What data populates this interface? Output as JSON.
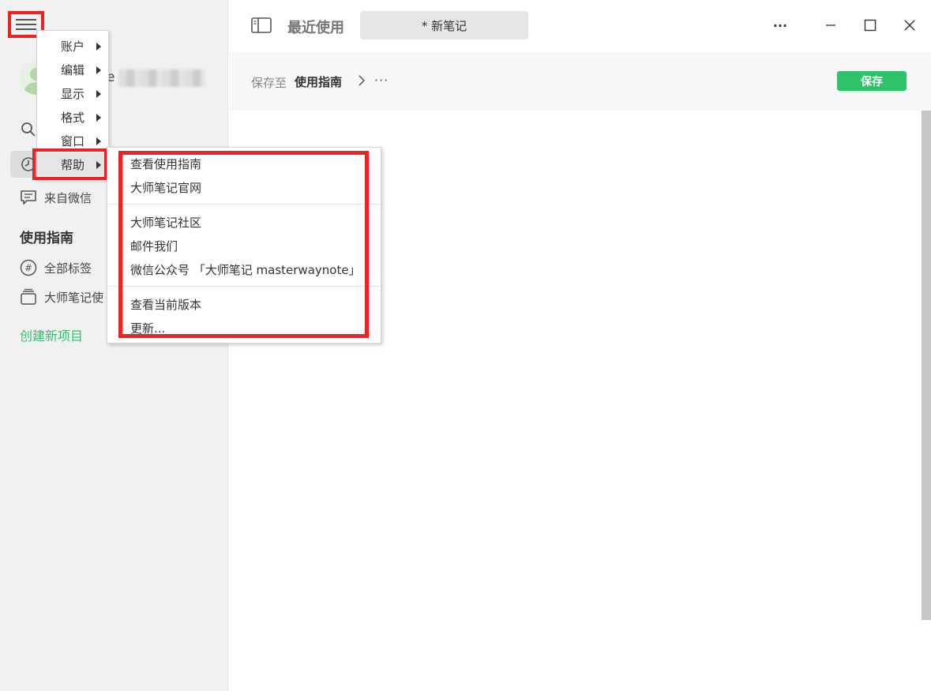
{
  "sidebar": {
    "username_visible": "e",
    "items": [
      {
        "label": "",
        "icon": "search-icon"
      },
      {
        "label": "",
        "icon": "clock-icon"
      },
      {
        "label": "来自微信",
        "icon": "chat-icon"
      }
    ],
    "section_title": "使用指南",
    "section_items": [
      {
        "label": "全部标签",
        "icon": "hash-icon"
      },
      {
        "label": "大师笔记使",
        "icon": "stack-icon"
      }
    ],
    "create_label": "创建新项目"
  },
  "topbar": {
    "recent_label": "最近使用",
    "tab_label": "* 新笔记",
    "more_label": "···"
  },
  "subbar": {
    "saveto_prefix": "保存至",
    "saveto_target": "使用指南",
    "more_label": "···",
    "save_label": "保存"
  },
  "menu": {
    "items": [
      {
        "label": "账户"
      },
      {
        "label": "编辑"
      },
      {
        "label": "显示"
      },
      {
        "label": "格式"
      },
      {
        "label": "窗口"
      },
      {
        "label": "帮助"
      }
    ]
  },
  "help_menu": {
    "groups": [
      [
        "查看使用指南",
        "大师笔记官网"
      ],
      [
        "大师笔记社区",
        "邮件我们",
        "微信公众号 「大师笔记 masterwaynote」"
      ],
      [
        "查看当前版本",
        "更新..."
      ]
    ]
  },
  "colors": {
    "accent": "#2ec36b",
    "highlight": "#ee2222",
    "sidebar_bg": "#f1f1f1"
  }
}
